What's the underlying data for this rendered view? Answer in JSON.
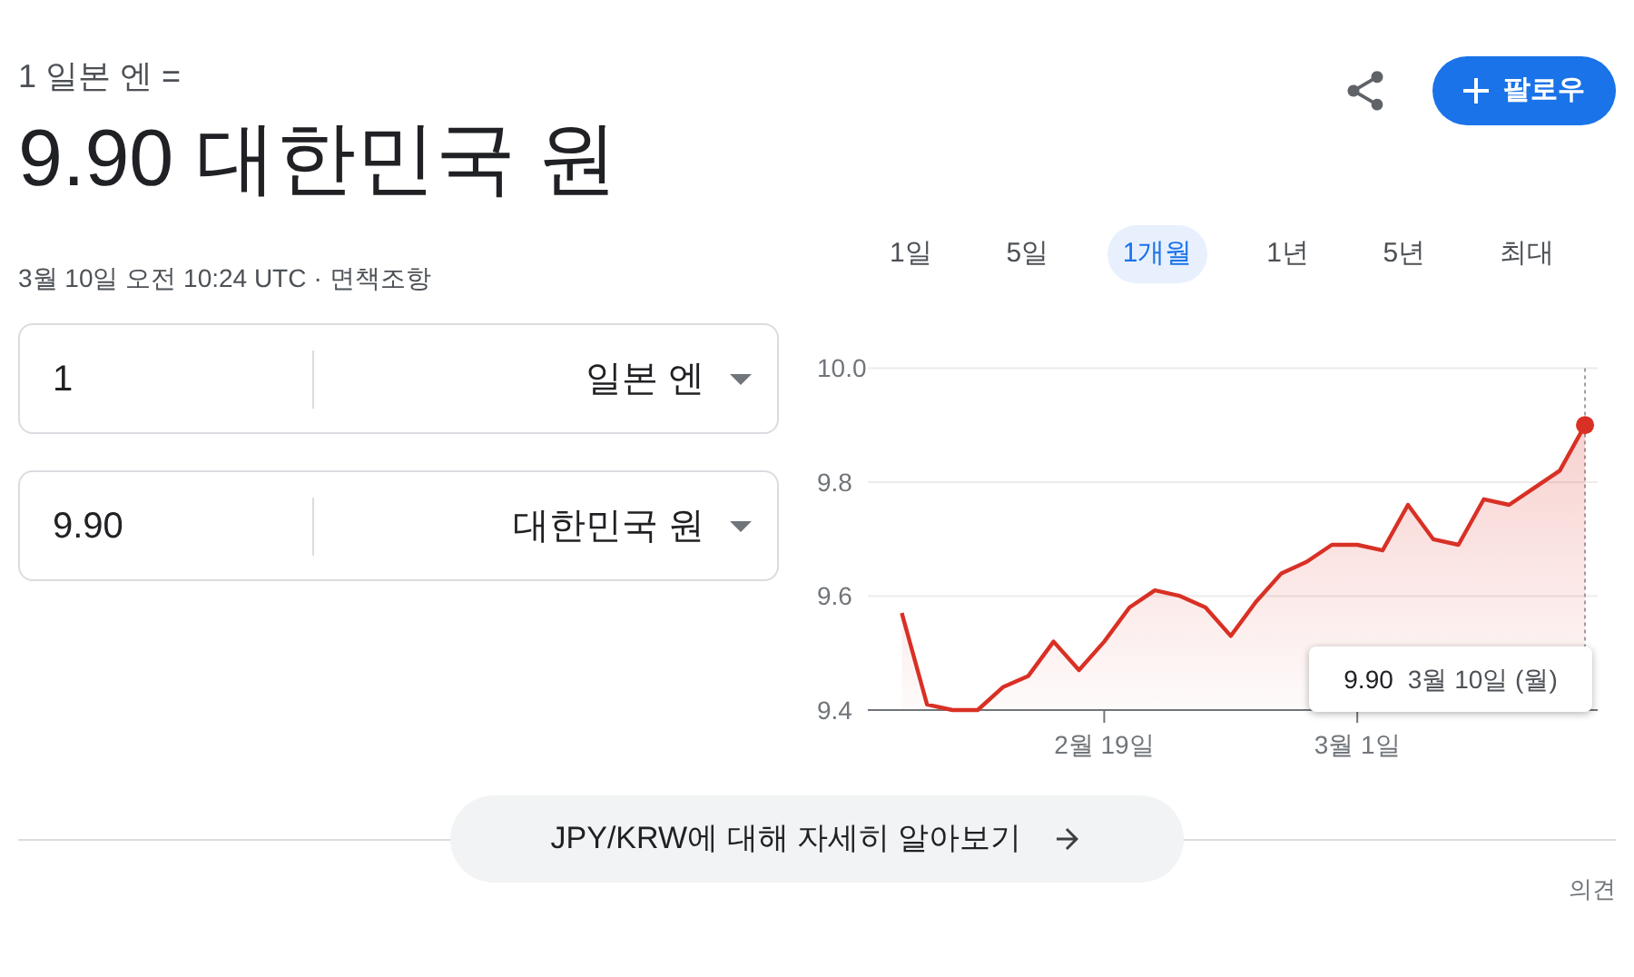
{
  "header": {
    "subtitle": "1 일본 엔 =",
    "value": "9.90 대한민국 원",
    "timestamp": "3월 10일 오전 10:24 UTC",
    "separator": "·",
    "disclaimer": "면책조항"
  },
  "follow_button": {
    "label": "팔로우"
  },
  "ranges": [
    {
      "label": "1일",
      "selected": false
    },
    {
      "label": "5일",
      "selected": false
    },
    {
      "label": "1개월",
      "selected": true
    },
    {
      "label": "1년",
      "selected": false
    },
    {
      "label": "5년",
      "selected": false
    },
    {
      "label": "최대",
      "selected": false
    }
  ],
  "converters": [
    {
      "amount": "1",
      "currency": "일본 엔"
    },
    {
      "amount": "9.90",
      "currency": "대한민국 원"
    }
  ],
  "chart": {
    "chart_data": {
      "type": "area",
      "series": [
        {
          "color": "#d93025",
          "values": [
            9.57,
            9.41,
            9.4,
            9.4,
            9.44,
            9.46,
            9.52,
            9.47,
            9.52,
            9.58,
            9.61,
            9.6,
            9.58,
            9.53,
            9.59,
            9.64,
            9.66,
            9.69,
            9.69,
            9.68,
            9.76,
            9.7,
            9.69,
            9.77,
            9.76,
            9.79,
            9.82,
            9.9
          ]
        }
      ],
      "ylim": [
        9.4,
        10.0
      ],
      "categories": [
        null,
        null,
        null,
        null,
        null,
        null,
        null,
        null,
        "2월 19일",
        null,
        null,
        null,
        null,
        null,
        null,
        null,
        null,
        null,
        "3월 1일",
        null,
        null,
        null,
        null,
        null,
        null,
        null,
        null,
        null
      ],
      "yticks": [
        {
          "value": 9.4,
          "label": "9.4"
        },
        {
          "value": 9.6,
          "label": "9.6"
        },
        {
          "value": 9.8,
          "label": "9.8"
        },
        {
          "value": 10,
          "label": "10.0"
        }
      ]
    },
    "tooltip": {
      "value": "9.90",
      "date": "3월 10일 (월)"
    }
  },
  "more_button": {
    "label": "JPY/KRW에 대해 자세히 알아보기"
  },
  "feedback": "의견"
}
